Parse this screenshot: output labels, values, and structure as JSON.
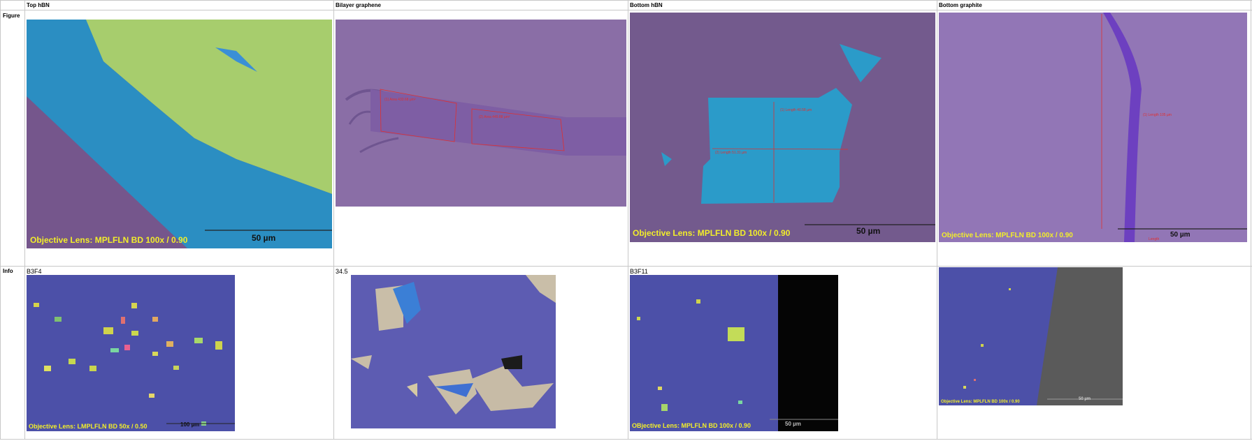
{
  "columns": [
    "Top hBN",
    "Bilayer graphene",
    "Bottom hBN",
    "Bottom graphite"
  ],
  "rows": [
    "Figure",
    "Info"
  ],
  "figure_images": [
    {
      "lens": "Objective Lens:  MPLFLN BD 100x / 0.90",
      "scale": "50 µm"
    },
    {
      "measurements": [
        "(1) Area 433.68 µm²",
        "(2) Area 449.88 µm²"
      ]
    },
    {
      "lens": "Objective Lens:  MPLFLN BD 100x / 0.90",
      "scale": "50 µm",
      "measurements": [
        "(1) Length 40.58 µm",
        "(2) Length 51.31 µm"
      ]
    },
    {
      "lens": "Objective Lens:  MPLFLN BD 100x / 0.90",
      "scale": "50 µm",
      "measurements": [
        "(1) Length 105 µm",
        "Length"
      ]
    }
  ],
  "info_labels": [
    "B3F4",
    "34.5",
    "B3F11",
    ""
  ],
  "info_images": [
    {
      "lens": "Objective Lens:  LMPLFLN BD 50x / 0.50",
      "scale": "100 µm"
    },
    {},
    {
      "lens": "OBjective Lens:  MPLFLN BD 100x / 0.90",
      "scale": "50 µm"
    },
    {
      "lens": "Objective Lens:  MPLFLN BD 100x / 0.90",
      "scale": "50 µm"
    }
  ],
  "colors": {
    "substrate_purple": "#7e6596",
    "hbn_blue": "#2a8dc0",
    "hbn_green": "#a8cf6c",
    "chip_blue": "#4c50a8",
    "measure_red": "#e03030",
    "lens_yellow": "#f2ee2a"
  }
}
